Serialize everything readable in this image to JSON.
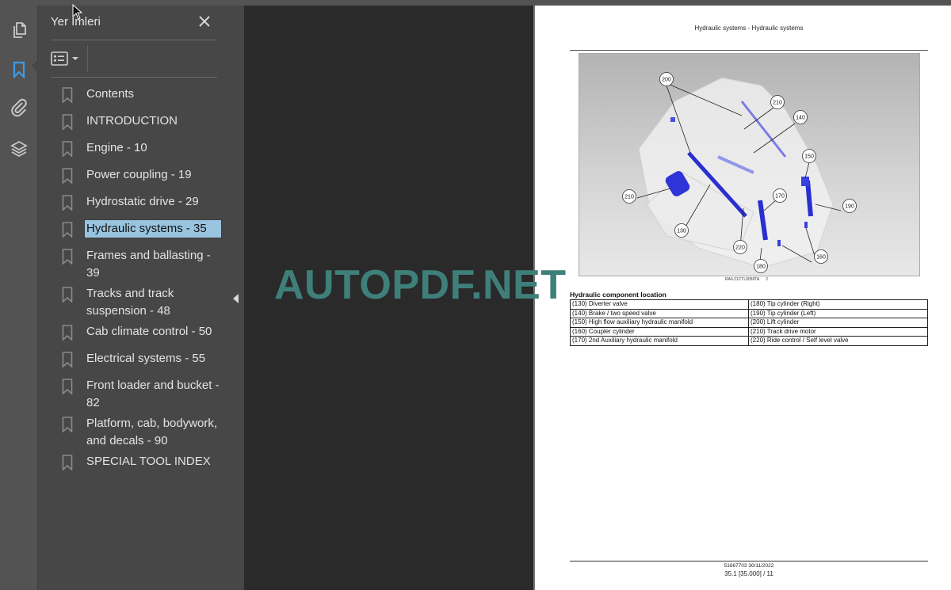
{
  "sidebar": {
    "rail_icons": [
      "pages-thumbnail-icon",
      "bookmark-icon",
      "attachment-icon",
      "layers-icon"
    ],
    "active_rail": "bookmark-icon",
    "accent_color": "#3d9bea"
  },
  "bookmarks_panel": {
    "title": "Yer İmleri",
    "close_label": "✕",
    "options_icon": "list-options-icon",
    "items": [
      {
        "label": "Contents"
      },
      {
        "label": "INTRODUCTION"
      },
      {
        "label": "Engine - 10"
      },
      {
        "label": "Power coupling - 19"
      },
      {
        "label": "Hydrostatic drive - 29"
      },
      {
        "label": "Hydraulic systems - 35",
        "selected": true
      },
      {
        "label": "Frames and ballasting - 39"
      },
      {
        "label": "Tracks and track suspension - 48"
      },
      {
        "label": "Cab climate control - 50"
      },
      {
        "label": "Electrical systems - 55"
      },
      {
        "label": "Front loader and bucket - 82"
      },
      {
        "label": "Platform, cab, bodywork, and decals - 90"
      },
      {
        "label": "SPECIAL TOOL INDEX"
      }
    ],
    "selected_color": "#99c4e0"
  },
  "watermark": "AUTOPDF.NET",
  "document": {
    "header": "Hydraulic systems - Hydraulic systems",
    "figure": {
      "callouts": [
        "200",
        "210",
        "140",
        "150",
        "190",
        "170",
        "210",
        "130",
        "220",
        "180",
        "160"
      ],
      "caption_code": "RAIL21CTL0058TA",
      "caption_number": "2"
    },
    "table_title": "Hydraulic component location",
    "table_rows": [
      [
        "(130) Diverter valve",
        "(180) Tip cylinder (Right)"
      ],
      [
        "(140) Brake / two speed valve",
        "(190) Tip cylinder (Left)"
      ],
      [
        "(150) High flow auxiliary hydraulic manifold",
        "(200) Lift cylinder"
      ],
      [
        "(160) Coupler cylinder",
        "(210) Track drive motor"
      ],
      [
        "(170) 2nd Auxiliary hydraulic manifold",
        "(220) Ride control / Self level valve"
      ]
    ],
    "footer_line1": "51667703 30/11/2022",
    "footer_line2": "35.1 [35.000] / 11"
  }
}
